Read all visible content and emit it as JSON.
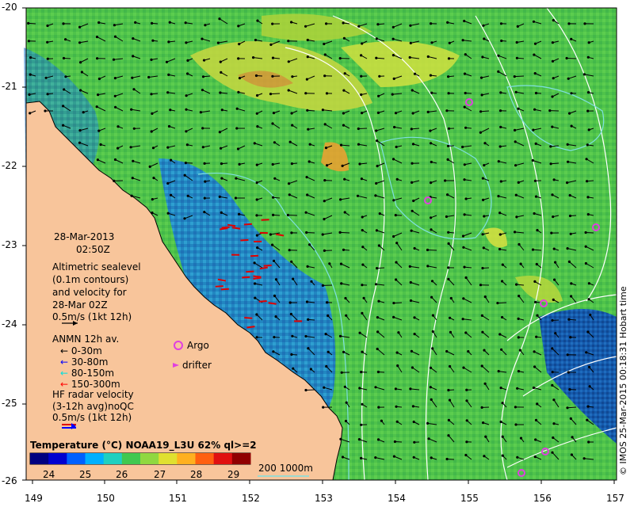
{
  "map": {
    "lat_ticks": [
      "-20",
      "-21",
      "-22",
      "-23",
      "-24",
      "-25",
      "-26"
    ],
    "lon_ticks": [
      "149",
      "150",
      "151",
      "152",
      "153",
      "154",
      "155",
      "156",
      "157"
    ],
    "colors": {
      "land": "#f8c59b",
      "water_bg": "#52c84a",
      "contour_200": "#7ee0e0",
      "contour_1000": "#ffffff",
      "argo": "#e040e0",
      "arrow": "#000000",
      "anmn_mid": "#ff00ff",
      "hf_radar": "#e00000"
    }
  },
  "legend": {
    "date": "28-Mar-2013",
    "time": "02:50Z",
    "alt_lines": [
      "Altimetric sealevel",
      "(0.1m contours)",
      "and velocity for",
      "28-Mar 02Z",
      "0.5m/s (1kt 12h)"
    ],
    "anmn_title": "ANMN 12h av.",
    "anmn_items": [
      {
        "label": "0-30m",
        "color": "#000000"
      },
      {
        "label": "30-80m",
        "color": "#0000ff"
      },
      {
        "label": "80-150m",
        "color": "#00e0e0"
      },
      {
        "label": "150-300m",
        "color": "#ff0000"
      }
    ],
    "hf_lines": [
      "HF radar velocity",
      "(3-12h avg)noQC",
      "0.5m/s (1kt 12h)"
    ],
    "argo_label": "Argo",
    "drifter_label": "drifter",
    "colorbar_title": "Temperature (°C) NOAA19_L3U 62% ql>=2",
    "colorbar_ticks": [
      "24",
      "25",
      "26",
      "27",
      "28",
      "29"
    ],
    "depth_legend": "200  1000m"
  },
  "side_label": "© IMOS 25-Mar-2015 00:18:31 Hobart time"
}
